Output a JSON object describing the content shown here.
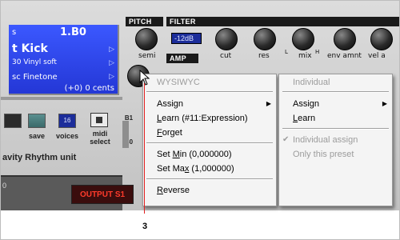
{
  "lcd": {
    "line1_left": "s",
    "line1_right": "1.B0",
    "line2": "t Kick",
    "line3": "30 Vinyl soft",
    "line4": "sc Finetone",
    "line5": "(+0) 0 cents"
  },
  "controls": {
    "pitch_tab": "PITCH",
    "filter_tab": "FILTER",
    "amp_tab": "AMP",
    "semi_label": "semi",
    "db_value": "-12dB",
    "cut_label": "cut",
    "res_label": "res",
    "mix_label": "mix",
    "mix_l": "L",
    "mix_h": "H",
    "env_amnt_label": "env amnt",
    "vel_label": "vel a",
    "save_label": "save",
    "voices_label": "voices",
    "voices_value": "16",
    "midi_label": "midi",
    "select_label": "select",
    "b1_label": "B1",
    "b0_label": "B0",
    "rhythm_label": "avity  Rhythm unit",
    "lower_value": "0",
    "output_label": "OUTPUT S1"
  },
  "menu_left": {
    "header": "WYSIWYC",
    "assign": "Assign",
    "learn_L": "L",
    "learn_rest": "earn (#11:Expression)",
    "forget_F": "F",
    "forget_rest": "orget",
    "setmin_prefix": "Set ",
    "setmin_M": "M",
    "setmin_rest": "in  (0,000000)",
    "setmax_prefix": "Set Ma",
    "setmax_x": "x",
    "setmax_rest": "  (1,000000)",
    "reverse_R": "R",
    "reverse_rest": "everse"
  },
  "menu_right": {
    "header": "Individual",
    "assign": "Assign",
    "learn_L": "L",
    "learn_rest": "earn",
    "individual_assign": "Individual assign",
    "only_this_preset": "Only this preset",
    "check_mark": "✔"
  },
  "callout": {
    "number": "3"
  },
  "colors": {
    "lcd_blue": "#2f47ef",
    "output_red": "#ff3b2b",
    "pointer_line": "#e02020",
    "menu_bg": "#f4f4f4",
    "disabled_text": "#9c9c9c"
  }
}
